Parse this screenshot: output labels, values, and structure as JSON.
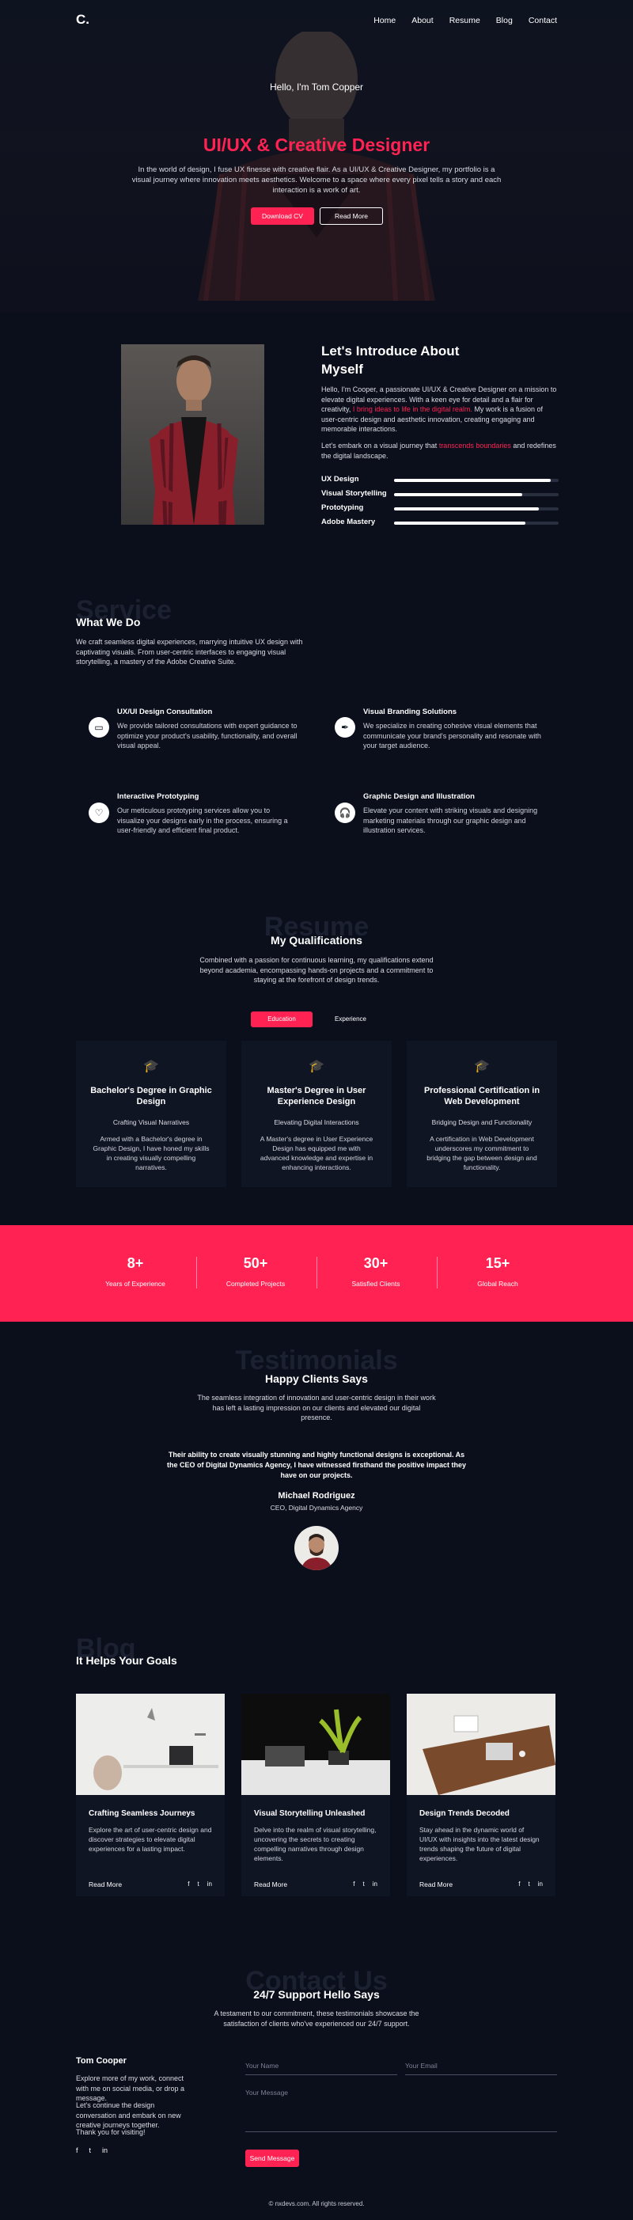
{
  "nav": {
    "logo": "C.",
    "items": [
      "Home",
      "About",
      "Resume",
      "Blog",
      "Contact"
    ]
  },
  "hero": {
    "greeting": "Hello, I'm Tom Copper",
    "title": "UI/UX & Creative Designer",
    "description": "In the world of design, I fuse UX finesse with creative flair. As a UI/UX & Creative Designer, my portfolio is a visual journey where innovation meets aesthetics. Welcome to a space where every pixel tells a story and each interaction is a work of art.",
    "download_label": "Download CV",
    "read_more_label": "Read More"
  },
  "about": {
    "title_line1": "Let's Introduce About",
    "title_line2": "Myself",
    "p1_a": "Hello, I'm Cooper, a passionate UI/UX & Creative Designer on a mission to elevate digital experiences. With a keen eye for detail and a flair for creativity, ",
    "p1_highlight": "I bring ideas to life in the digital realm.",
    "p1_b": " My work is a fusion of user-centric design and aesthetic innovation, creating engaging and memorable interactions.",
    "p2_a": "Let's embark on a visual journey that ",
    "p2_highlight": "transcends boundaries",
    "p2_b": " and redefines the digital landscape.",
    "skills": [
      {
        "label": "UX Design",
        "level": 0.95
      },
      {
        "label": "Visual Storytelling",
        "level": 0.78
      },
      {
        "label": "Prototyping",
        "level": 0.88
      },
      {
        "label": "Adobe Mastery",
        "level": 0.8
      }
    ]
  },
  "services": {
    "ghost": "Service",
    "title": "What We Do",
    "description": "We craft seamless digital experiences, marrying intuitive UX design with captivating visuals. From user-centric interfaces to engaging visual storytelling, a mastery of the Adobe Creative Suite.",
    "items": [
      {
        "title": "UX/UI Design Consultation",
        "text": "We provide tailored consultations with expert guidance to optimize your product's usability, functionality, and overall visual appeal.",
        "icon": "monitor-icon"
      },
      {
        "title": "Visual Branding Solutions",
        "text": "We specialize in creating cohesive visual elements that communicate your brand's personality and resonate with your target audience.",
        "icon": "pen-nib-icon"
      },
      {
        "title": "Interactive Prototyping",
        "text": "Our meticulous prototyping services allow you to visualize your designs early in the process, ensuring a user-friendly and efficient final product.",
        "icon": "heart-icon"
      },
      {
        "title": "Graphic Design and Illustration",
        "text": "Elevate your content with striking visuals and designing marketing materials through our graphic design and illustration services.",
        "icon": "headphones-icon"
      }
    ]
  },
  "resume": {
    "ghost": "Resume",
    "title": "My Qualifications",
    "description": "Combined with a passion for continuous learning, my qualifications extend beyond academia, encompassing hands-on projects and a commitment to staying at the forefront of design trends.",
    "tabs": [
      "Education",
      "Experience"
    ],
    "cards": [
      {
        "title": "Bachelor's Degree in Graphic Design",
        "subtitle": "Crafting Visual Narratives",
        "text": "Armed with a Bachelor's degree in Graphic Design, I have honed my skills in creating visually compelling narratives."
      },
      {
        "title": "Master's Degree in User Experience Design",
        "subtitle": "Elevating Digital Interactions",
        "text": "A Master's degree in User Experience Design has equipped me with advanced knowledge and expertise in enhancing interactions."
      },
      {
        "title": "Professional Certification in Web Development",
        "subtitle": "Bridging Design and Functionality",
        "text": "A certification in Web Development underscores my commitment to bridging the gap between design and functionality."
      }
    ]
  },
  "stats": [
    {
      "number": "8+",
      "label": "Years of Experience"
    },
    {
      "number": "50+",
      "label": "Completed Projects"
    },
    {
      "number": "30+",
      "label": "Satisfied Clients"
    },
    {
      "number": "15+",
      "label": "Global Reach"
    }
  ],
  "testimonials": {
    "ghost": "Testimonials",
    "title": "Happy Clients Says",
    "description": "The seamless integration of innovation and user-centric design in their work has left a lasting impression on our clients and elevated our digital presence.",
    "quote": "Their ability to create visually stunning and highly functional designs is exceptional. As the CEO of Digital Dynamics Agency, I have witnessed firsthand the positive impact they have on our projects.",
    "name": "Michael Rodriguez",
    "role": "CEO, Digital Dynamics Agency"
  },
  "blog": {
    "ghost": "Blog",
    "title": "It Helps Your Goals",
    "read_more": "Read More",
    "social": [
      "f",
      "t",
      "in"
    ],
    "posts": [
      {
        "title": "Crafting Seamless Journeys",
        "text": "Explore the art of user-centric design and discover strategies to elevate digital experiences for a lasting impact."
      },
      {
        "title": "Visual Storytelling Unleashed",
        "text": "Delve into the realm of visual storytelling, uncovering the secrets to creating compelling narratives through design elements."
      },
      {
        "title": "Design Trends Decoded",
        "text": "Stay ahead in the dynamic world of UI/UX with insights into the latest design trends shaping the future of digital experiences."
      }
    ]
  },
  "contact": {
    "ghost": "Contact Us",
    "title": "24/7 Support Hello Says",
    "description": "A testament to our commitment, these testimonials showcase the satisfaction of clients who've experienced our 24/7 support.",
    "name": "Tom Cooper",
    "p1": "Explore more of my work, connect with me on social media, or drop a message.",
    "p2": "Let's continue the design conversation and embark on new creative journeys together.",
    "p3": "Thank you for visiting!",
    "social": [
      "f",
      "t",
      "in"
    ],
    "name_placeholder": "Your Name",
    "email_placeholder": "Your Email",
    "message_placeholder": "Your Message",
    "send_label": "Send Message"
  },
  "footer": "© nxdevs.com. All rights reserved.",
  "colors": {
    "accent": "#ff2252",
    "background": "#0b0f1c",
    "card": "#101524"
  }
}
